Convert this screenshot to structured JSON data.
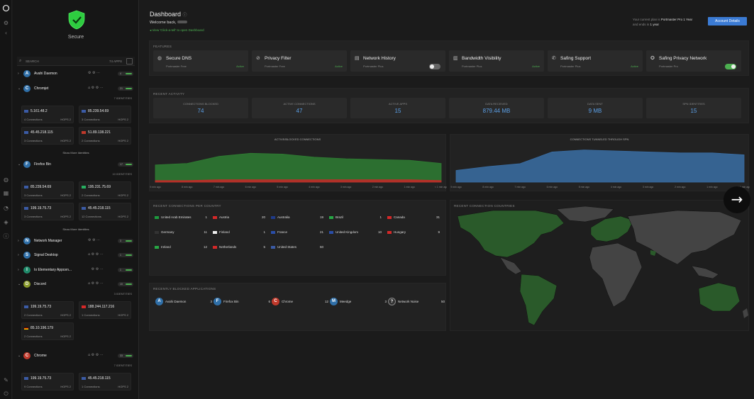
{
  "status": {
    "label": "Secure",
    "color": "#2ecc40"
  },
  "search": {
    "placeholder": "SEARCH",
    "count": "74 APPS"
  },
  "apps": [
    {
      "name": "Avahi Daemon",
      "letter": "A",
      "color": "#2f6fa8",
      "expanded": false,
      "pill": "4"
    },
    {
      "name": "Chromjet",
      "letter": "C",
      "color": "#2f6fa8",
      "expanded": true,
      "pill": "21",
      "identities": "7 IDENTITIES"
    },
    {
      "name": "Firefox Bin",
      "letter": "F",
      "color": "#2f6fa8",
      "expanded": true,
      "pill": "17",
      "identities": "10 IDENTITIES"
    },
    {
      "name": "Network Manager",
      "letter": "N",
      "color": "#2f6fa8",
      "expanded": false,
      "pill": "3"
    },
    {
      "name": "Signal Desktop",
      "letter": "S",
      "color": "#2f6fa8",
      "expanded": false,
      "pill": "1"
    },
    {
      "name": "Io Elementary Appcen...",
      "letter": "I",
      "color": "#1f8a6a",
      "expanded": false,
      "pill": "1"
    },
    {
      "name": "Discord",
      "letter": "D",
      "color": "#8a9a2a",
      "expanded": true,
      "pill": "10",
      "identities": "3 IDENTITIES"
    },
    {
      "name": "Chrome",
      "letter": "C",
      "color": "#c0392b",
      "expanded": true,
      "pill": "33",
      "identities": "7 IDENTITIES"
    }
  ],
  "connections": {
    "chromjet": [
      {
        "ip": "5.161.48.2",
        "flag": "us",
        "connections": "4 Connections",
        "hops": "HOPS 2"
      },
      {
        "ip": "85.239.54.69",
        "flag": "us",
        "connections": "3 Connections",
        "hops": "HOPS 2"
      },
      {
        "ip": "45.45.218.115",
        "flag": "us",
        "connections": "3 Connections",
        "hops": "HOPS 2"
      },
      {
        "ip": "51.89.138.221",
        "flag": "uk",
        "connections": "2 Connections",
        "hops": "HOPS 2"
      }
    ],
    "firefox": [
      {
        "ip": "85.239.54.69",
        "flag": "us",
        "connections": "3 Connections",
        "hops": "HOPS 2"
      },
      {
        "ip": "195.231.75.69",
        "flag": "it",
        "connections": "2 Connections",
        "hops": "HOPS 2"
      },
      {
        "ip": "199.19.75.73",
        "flag": "us",
        "connections": "3 Connections",
        "hops": "HOPS 2"
      },
      {
        "ip": "45.45.218.115",
        "flag": "us",
        "connections": "12 Connections",
        "hops": "HOPS 2"
      }
    ],
    "discord": [
      {
        "ip": "199.19.75.73",
        "flag": "us",
        "connections": "2 Connections",
        "hops": "HOPS 2"
      },
      {
        "ip": "188.244.117.216",
        "flag": "ch",
        "connections": "1 Connections",
        "hops": "HOPS 2"
      },
      {
        "ip": "85.10.196.179",
        "flag": "de",
        "connections": "2 Connections",
        "hops": "HOPS 2"
      }
    ],
    "chrome": [
      {
        "ip": "199.19.75.73",
        "flag": "us",
        "connections": "9 Connections",
        "hops": "HOPS 2"
      },
      {
        "ip": "45.45.218.115",
        "flag": "us",
        "connections": "1 Connections",
        "hops": "HOPS 2"
      }
    ]
  },
  "show_more": "Show More Identities",
  "header": {
    "title": "Dashboard",
    "welcome": "Welcome back,",
    "tour": "View 'Click-a-tell' to open Dashboard",
    "plan_line1_prefix": "Your current plan is",
    "plan_name": "Portmaster Pro 1 Year",
    "plan_line2_prefix": "and ends in",
    "plan_ends": "1 year",
    "account_button": "Account Details"
  },
  "features": {
    "heading": "FEATURES",
    "items": [
      {
        "name": "Secure DNS",
        "sub": "Portmaster Free",
        "state": "Active",
        "icon": "globe-icon"
      },
      {
        "name": "Privacy Filter",
        "sub": "Portmaster Free",
        "state": "Active",
        "icon": "filter-off-icon"
      },
      {
        "name": "Network History",
        "sub": "Portmaster Plus",
        "state": "toggle-off",
        "icon": "history-icon"
      },
      {
        "name": "Bandwidth Visibility",
        "sub": "Portmaster Plus",
        "state": "Active",
        "icon": "bar-chart-icon"
      },
      {
        "name": "Safing Support",
        "sub": "Portmaster Plus",
        "state": "Active",
        "icon": "support-icon"
      },
      {
        "name": "Safing Privacy Network",
        "sub": "Portmaster Pro",
        "state": "toggle-on",
        "icon": "spn-icon"
      }
    ]
  },
  "activity": {
    "heading": "RECENT ACTIVITY",
    "stats": [
      {
        "label": "CONNECTIONS BLOCKED",
        "value": "74"
      },
      {
        "label": "ACTIVE CONNECTIONS",
        "value": "47"
      },
      {
        "label": "ACTIVE APPS",
        "value": "15"
      },
      {
        "label": "DATA RECEIVED",
        "value": "879.44 MB"
      },
      {
        "label": "DATA SENT",
        "value": "9 MB"
      },
      {
        "label": "SPN IDENTITIES",
        "value": "15"
      }
    ]
  },
  "chart_data": [
    {
      "type": "area",
      "title": "ACTIVE/BLOCKED CONNECTIONS",
      "x": [
        "9 min ago",
        "8 min ago",
        "7 min ago",
        "6 min ago",
        "5 min ago",
        "4 min ago",
        "3 min ago",
        "2 min ago",
        "1 min ago",
        "< 1 min ago"
      ],
      "series": [
        {
          "name": "",
          "color": "#2e7d32",
          "values": [
            22,
            24,
            33,
            37,
            36,
            32,
            30,
            29,
            28,
            24
          ]
        },
        {
          "name": "",
          "color": "#c62828",
          "values": [
            2,
            2,
            3,
            3,
            3,
            3,
            3,
            3,
            3,
            2
          ]
        }
      ],
      "ylim": [
        0,
        50
      ]
    },
    {
      "type": "area",
      "title": "CONNECTIONS TUNNELED THROUGH SPN",
      "x": [
        "9 min ago",
        "8 min ago",
        "7 min ago",
        "6 min ago",
        "5 min ago",
        "4 min ago",
        "3 min ago",
        "2 min ago",
        "1 min ago",
        "< 1 min ago"
      ],
      "series": [
        {
          "name": "",
          "color": "#3a6ea5",
          "values": [
            12,
            16,
            19,
            31,
            33,
            32,
            31,
            30,
            30,
            28
          ]
        }
      ],
      "ylim": [
        0,
        40
      ]
    }
  ],
  "countries": {
    "heading": "RECENT CONNECTIONS PER COUNTRY",
    "items": [
      {
        "name": "United Arab Emirates",
        "count": "1",
        "flag": "ae"
      },
      {
        "name": "Austria",
        "count": "20",
        "flag": "at"
      },
      {
        "name": "Australia",
        "count": "19",
        "flag": "au"
      },
      {
        "name": "Brazil",
        "count": "1",
        "flag": "br"
      },
      {
        "name": "Canada",
        "count": "31",
        "flag": "ca"
      },
      {
        "name": "Germany",
        "count": "11",
        "flag": "de"
      },
      {
        "name": "Finland",
        "count": "1",
        "flag": "fi"
      },
      {
        "name": "France",
        "count": "21",
        "flag": "fr"
      },
      {
        "name": "United Kingdom",
        "count": "10",
        "flag": "uk"
      },
      {
        "name": "Hungary",
        "count": "9",
        "flag": "hu"
      },
      {
        "name": "Ireland",
        "count": "12",
        "flag": "ie"
      },
      {
        "name": "Netherlands",
        "count": "5",
        "flag": "nl"
      },
      {
        "name": "United States",
        "count": "50",
        "flag": "us"
      }
    ]
  },
  "map": {
    "heading": "RECENT CONNECTION COUNTRIES"
  },
  "blocked": {
    "heading": "RECENTLY BLOCKED APPLICATIONS",
    "items": [
      {
        "letter": "A",
        "name": "Avahi Daemon",
        "count": "3",
        "color": "#2f6fa8"
      },
      {
        "letter": "F",
        "name": "Firefox Bin",
        "count": "6",
        "color": "#2f6fa8"
      },
      {
        "letter": "C",
        "name": "Chrome",
        "count": "12",
        "color": "#c0392b"
      },
      {
        "letter": "M",
        "name": "Meedge",
        "count": "3",
        "color": "#2f6fa8"
      },
      {
        "letter": "?",
        "name": "Network Noise",
        "count": "50",
        "color": "#333333"
      }
    ]
  }
}
